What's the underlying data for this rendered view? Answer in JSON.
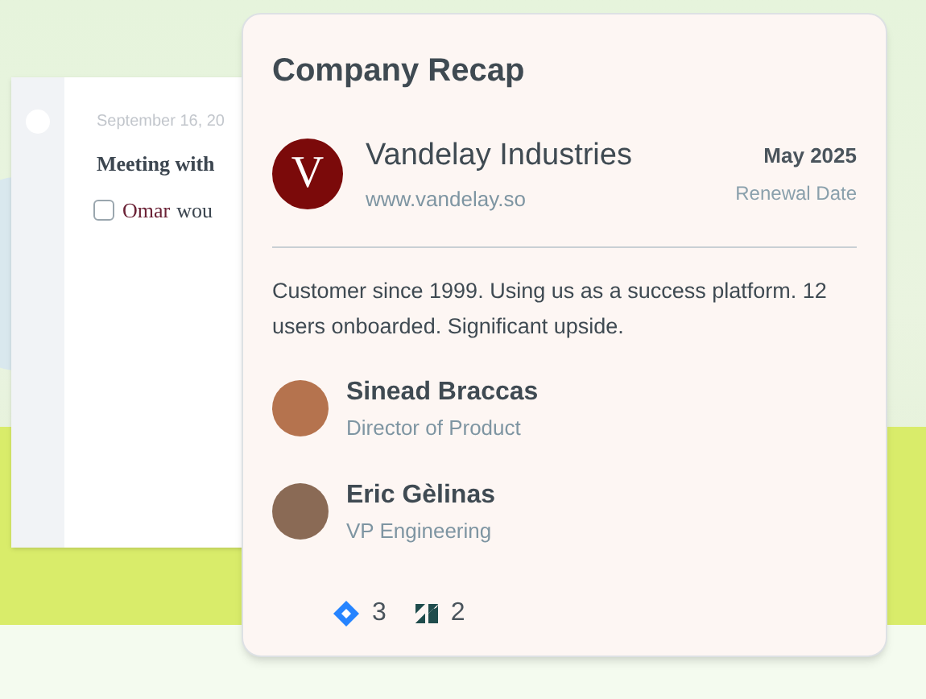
{
  "note": {
    "date": "September 16, 20",
    "title": "Meeting with",
    "task": {
      "checked": false,
      "mention": "Omar",
      "text": "wou"
    }
  },
  "recap": {
    "title": "Company Recap",
    "company": {
      "initial": "V",
      "name": "Vandelay Industries",
      "website": "www.vandelay.so",
      "renewal": "May 2025",
      "renewal_label": "Renewal Date"
    },
    "summary": "Customer since 1999. Using us as a success platform. 12 users onboarded. Significant upside.",
    "contacts": [
      {
        "name": "Sinead Braccas",
        "role": "Director of Product"
      },
      {
        "name": "Eric Gèlinas",
        "role": "VP Engineering"
      }
    ],
    "integrations": [
      {
        "kind": "jira",
        "count": "3"
      },
      {
        "kind": "zendesk",
        "count": "2"
      }
    ]
  }
}
